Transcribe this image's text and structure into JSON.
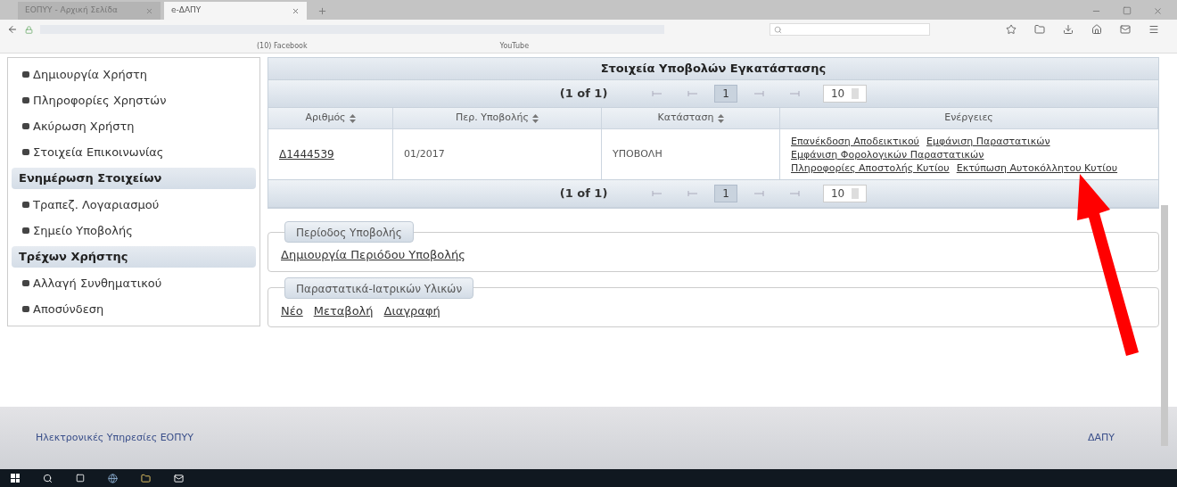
{
  "browser": {
    "tabs": [
      {
        "label": "ΕΟΠΥΥ - Αρχική Σελίδα",
        "selected": false
      },
      {
        "label": "e-ΔΑΠΥ",
        "selected": true
      }
    ],
    "bookmarks": [
      "(10) Facebook",
      "YouTube"
    ]
  },
  "sidebar": {
    "sections": [
      {
        "items": [
          "Δημιουργία Χρήστη",
          "Πληροφορίες Χρηστών",
          "Ακύρωση Χρήστη",
          "Στοιχεία Επικοινωνίας"
        ]
      },
      {
        "heading": "Ενημέρωση Στοιχείων",
        "items": [
          "Τραπεζ. Λογαριασμού",
          "Σημείο Υποβολής"
        ]
      },
      {
        "heading": "Τρέχων Χρήστης",
        "items": [
          "Αλλαγή Συνθηματικού",
          "Αποσύνδεση"
        ]
      }
    ]
  },
  "table": {
    "title": "Στοιχεία Υποβολών Εγκατάστασης",
    "paginators": [
      {
        "summary": "(1 of 1)",
        "current_page": "1",
        "rows_per_page": "10"
      },
      {
        "summary": "(1 of 1)",
        "current_page": "1",
        "rows_per_page": "10"
      }
    ],
    "columns": [
      {
        "label": "Αριθμός",
        "sortable": true
      },
      {
        "label": "Περ. Υποβολής",
        "sortable": true
      },
      {
        "label": "Κατάσταση",
        "sortable": true
      },
      {
        "label": "Ενέργειες",
        "sortable": false
      }
    ],
    "rows": [
      {
        "number": "Δ1444539",
        "period": "01/2017",
        "status": "ΥΠΟΒΟΛΗ",
        "actions": [
          "Επανέκδοση Αποδεικτικού",
          "Εμφάνιση Παραστατικών",
          "Εμφάνιση Φορολογικών Παραστατικών",
          "Πληροφορίες Αποστολής Κυτίου",
          "Εκτύπωση Αυτοκόλλητου Κυτίου"
        ]
      }
    ]
  },
  "fieldsets": [
    {
      "legend": "Περίοδος Υποβολής",
      "links": [
        "Δημιουργία Περιόδου Υποβολής"
      ]
    },
    {
      "legend": "Παραστατικά-Ιατρικών Υλικών",
      "links": [
        "Νέο",
        "Μεταβολή",
        "Διαγραφή"
      ]
    }
  ],
  "footer": {
    "left": "Ηλεκτρονικές Υπηρεσίες ΕΟΠΥΥ",
    "right": "ΔΑΠΥ"
  }
}
